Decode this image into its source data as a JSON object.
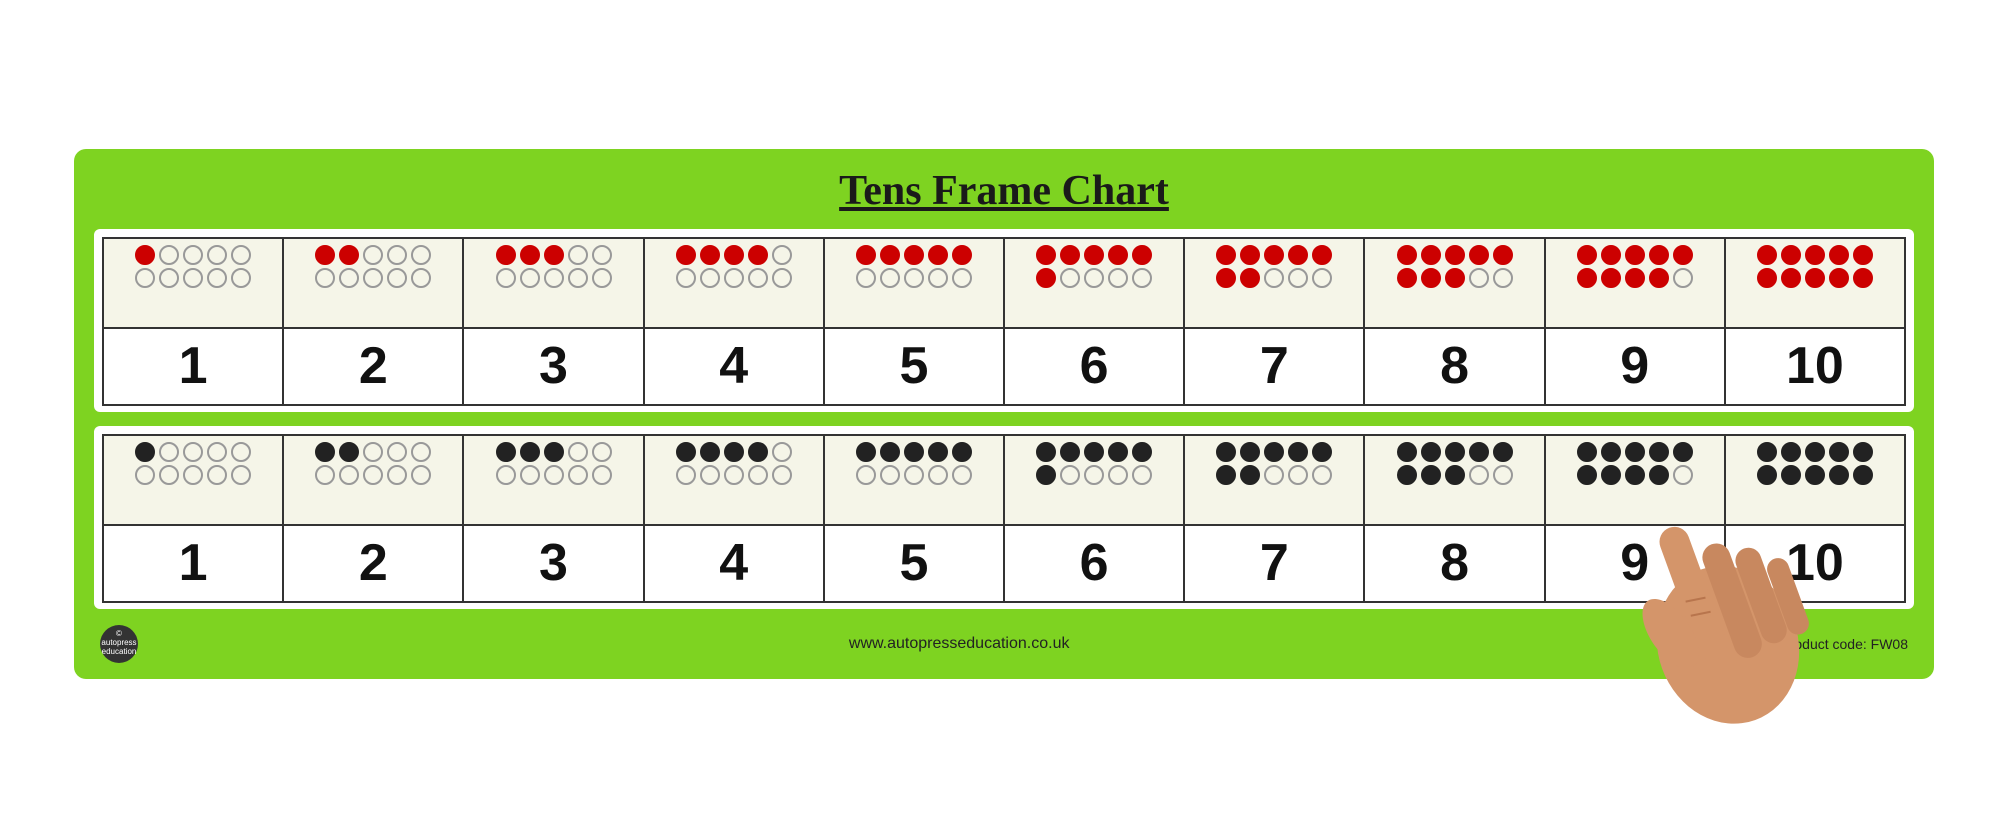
{
  "title": "Tens Frame Chart",
  "subtitle_underline": true,
  "background_color": "#7ed321",
  "red_row": {
    "frames": [
      {
        "number": "1",
        "top_filled": 1,
        "top_total": 5,
        "bottom_filled": 0,
        "bottom_total": 5
      },
      {
        "number": "2",
        "top_filled": 2,
        "top_total": 5,
        "bottom_filled": 0,
        "bottom_total": 5
      },
      {
        "number": "3",
        "top_filled": 3,
        "top_total": 5,
        "bottom_filled": 0,
        "bottom_total": 5
      },
      {
        "number": "4",
        "top_filled": 4,
        "top_total": 5,
        "bottom_filled": 0,
        "bottom_total": 5
      },
      {
        "number": "5",
        "top_filled": 5,
        "top_total": 5,
        "bottom_filled": 0,
        "bottom_total": 5
      },
      {
        "number": "6",
        "top_filled": 5,
        "top_total": 5,
        "bottom_filled": 1,
        "bottom_total": 5
      },
      {
        "number": "7",
        "top_filled": 5,
        "top_total": 5,
        "bottom_filled": 2,
        "bottom_total": 5
      },
      {
        "number": "8",
        "top_filled": 5,
        "top_total": 5,
        "bottom_filled": 3,
        "bottom_total": 5
      },
      {
        "number": "9",
        "top_filled": 5,
        "top_total": 5,
        "bottom_filled": 4,
        "bottom_total": 5
      },
      {
        "number": "10",
        "top_filled": 5,
        "top_total": 5,
        "bottom_filled": 5,
        "bottom_total": 5
      }
    ]
  },
  "black_row": {
    "frames": [
      {
        "number": "1",
        "top_filled": 1,
        "top_total": 5,
        "bottom_filled": 0,
        "bottom_total": 5
      },
      {
        "number": "2",
        "top_filled": 2,
        "top_total": 5,
        "bottom_filled": 0,
        "bottom_total": 5
      },
      {
        "number": "3",
        "top_filled": 3,
        "top_total": 5,
        "bottom_filled": 0,
        "bottom_total": 5
      },
      {
        "number": "4",
        "top_filled": 4,
        "top_total": 5,
        "bottom_filled": 0,
        "bottom_total": 5
      },
      {
        "number": "5",
        "top_filled": 5,
        "top_total": 5,
        "bottom_filled": 0,
        "bottom_total": 5
      },
      {
        "number": "6",
        "top_filled": 5,
        "top_total": 5,
        "bottom_filled": 1,
        "bottom_total": 5
      },
      {
        "number": "7",
        "top_filled": 5,
        "top_total": 5,
        "bottom_filled": 2,
        "bottom_total": 5
      },
      {
        "number": "8",
        "top_filled": 5,
        "top_total": 5,
        "bottom_filled": 3,
        "bottom_total": 5
      },
      {
        "number": "9",
        "top_filled": 5,
        "top_total": 5,
        "bottom_filled": 4,
        "bottom_total": 5
      },
      {
        "number": "10",
        "top_filled": 5,
        "top_total": 5,
        "bottom_filled": 5,
        "bottom_total": 5
      }
    ]
  },
  "footer": {
    "website": "www.autopresseducation.co.uk",
    "product_code": "Product code: FW08",
    "logo_line1": "©",
    "logo_line2": "autopress",
    "logo_line3": "education"
  }
}
